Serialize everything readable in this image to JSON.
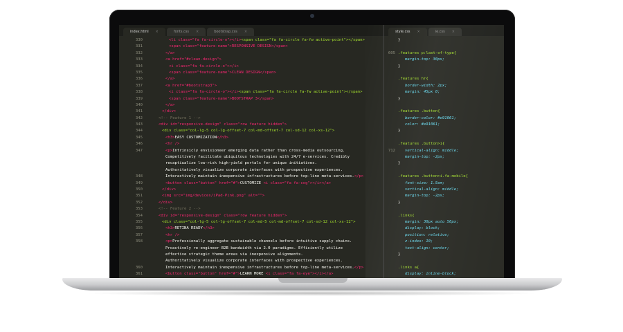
{
  "tabs_left": [
    {
      "label": "index.html",
      "active": true
    },
    {
      "label": "fonts.css",
      "active": false
    },
    {
      "label": "bootstrap.css",
      "active": false
    }
  ],
  "tabs_right": [
    {
      "label": "style.css",
      "active": true
    },
    {
      "label": "ie.css",
      "active": false
    }
  ],
  "left_lines": [
    {
      "n": "330",
      "segs": [
        [
          "<li class=\"fa fa-circle-o\"></i>",
          "t-tag"
        ],
        [
          "<span class=\"fa fa-circle fa-fw active-point\"></span>",
          "t-attr"
        ]
      ]
    },
    {
      "n": "331",
      "segs": [
        [
          "<span class=\"feature-name\">RESPONSIVE DESIGN</span>",
          "t-tag"
        ]
      ]
    },
    {
      "n": "332",
      "segs": [
        [
          "</a>",
          "t-tag"
        ]
      ]
    },
    {
      "n": "333",
      "segs": [
        [
          "<a href=\"#clean-design\">",
          "t-tag"
        ]
      ]
    },
    {
      "n": "334",
      "segs": [
        [
          "<i class=\"fa fa-circle-o\"></i>",
          "t-tag"
        ]
      ]
    },
    {
      "n": "335",
      "segs": [
        [
          "<span class=\"feature-name\">CLEAN DESIGN</span>",
          "t-tag"
        ]
      ]
    },
    {
      "n": "336",
      "segs": [
        [
          "</a>",
          "t-tag"
        ]
      ]
    },
    {
      "n": "337",
      "segs": [
        [
          "<a href=\"#bootstrap3\">",
          "t-tag"
        ]
      ]
    },
    {
      "n": "338",
      "segs": [
        [
          "<i class=\"fa fa-circle-o\"></i>",
          "t-tag"
        ],
        [
          "<span class=\"fa fa-circle fa-fw active-point\"></span>",
          "t-attr"
        ]
      ]
    },
    {
      "n": "339",
      "segs": [
        [
          "<span class=\"feature-name\">BOOTSTRAP 3</span>",
          "t-tag"
        ]
      ]
    },
    {
      "n": "340",
      "segs": [
        [
          "</a>",
          "t-tag"
        ]
      ]
    },
    {
      "n": "341",
      "segs": [
        [
          "</div>",
          "t-tag"
        ]
      ]
    },
    {
      "n": "342",
      "segs": [
        [
          "<!-- Feature 1 -->",
          "t-com"
        ]
      ]
    },
    {
      "n": "343",
      "segs": [
        [
          "<div id=\"responsive-design\" class=\"row feature hidden\">",
          "t-tag"
        ]
      ]
    },
    {
      "n": "344",
      "segs": [
        [
          "<div class=\"col-lg-5 col-lg-offset-7 col-md-offset-7 col-sd-12 col-xs-12\">",
          "t-attr"
        ]
      ]
    },
    {
      "n": "345",
      "segs": [
        [
          "<h3>",
          "t-tag"
        ],
        [
          "EASY CUSTOMIZATION",
          "txt"
        ],
        [
          "</h3>",
          "t-tag"
        ]
      ]
    },
    {
      "n": "346",
      "segs": [
        [
          "<hr />",
          "t-tag"
        ]
      ]
    },
    {
      "n": "347",
      "segs": [
        [
          "<p>",
          "t-tag"
        ],
        [
          "Intrinsicly envisioneer emerging data rather than cross-media outsourcing.",
          "txt"
        ]
      ]
    },
    {
      "n": "",
      "segs": [
        [
          "Competitively facilitate ubiquitous technologies with 24/7 e-services. Credibly",
          "txt"
        ]
      ]
    },
    {
      "n": "",
      "segs": [
        [
          "recaptiualize low-risk high-yield portals for unique initiatives.",
          "txt"
        ]
      ]
    },
    {
      "n": "",
      "segs": [
        [
          "Authoritatively visualize corporate interfaces with prospective experiences.",
          "txt"
        ]
      ]
    },
    {
      "n": "348",
      "segs": [
        [
          "Interactively maintain inexpensive infrastructures before top-line meta-services.",
          "txt"
        ],
        [
          "</p>",
          "t-tag"
        ]
      ]
    },
    {
      "n": "349",
      "segs": [
        [
          "<button class=\"button\" href=\"#\">",
          "t-tag"
        ],
        [
          "CUSTOMIZE ",
          "txt"
        ],
        [
          "<i class=\"fa fa-cog\"></i></a>",
          "t-tag"
        ]
      ]
    },
    {
      "n": "350",
      "segs": [
        [
          "</div>",
          "t-tag"
        ]
      ]
    },
    {
      "n": "351",
      "segs": [
        [
          "<img src=\"img/devices/iPad-Pink.png\" alt=\"\">",
          "t-tag"
        ]
      ]
    },
    {
      "n": "352",
      "segs": [
        [
          "</div>",
          "t-tag"
        ]
      ]
    },
    {
      "n": "353",
      "segs": [
        [
          "<!-- Feature 2 -->",
          "t-com"
        ]
      ]
    },
    {
      "n": "354",
      "segs": [
        [
          "<div id=\"responsive-design\" class=\"row feature hidden\">",
          "t-tag"
        ]
      ]
    },
    {
      "n": "355",
      "segs": [
        [
          "<div class=\"col-lg-5 col-lg-offset-7 col-md-5 col-md-offset-7 col-sd-12 col-xs-12\">",
          "t-attr"
        ]
      ]
    },
    {
      "n": "356",
      "segs": [
        [
          "<h3>",
          "t-tag"
        ],
        [
          "RETINA READY",
          "txt"
        ],
        [
          "</h3>",
          "t-tag"
        ]
      ]
    },
    {
      "n": "357",
      "segs": [
        [
          "<hr />",
          "t-tag"
        ]
      ]
    },
    {
      "n": "358",
      "segs": [
        [
          "<p>",
          "t-tag"
        ],
        [
          "Professionally aggregate sustainable channels before intuitive supply chains.",
          "txt"
        ]
      ]
    },
    {
      "n": "",
      "segs": [
        [
          "Proactively re-engineer B2B bandwidth via 2.0 paradigms. Efficiently utilize",
          "txt"
        ]
      ]
    },
    {
      "n": "",
      "segs": [
        [
          "effective strategic theme areas via inexpensive alignments.",
          "txt"
        ]
      ]
    },
    {
      "n": "",
      "segs": [
        [
          "Authoritatively visualize corporate interfaces with prospective experiences.",
          "txt"
        ]
      ]
    },
    {
      "n": "360",
      "segs": [
        [
          "Interactively maintain inexpensive infrastructures before top-line meta-services.",
          "txt"
        ],
        [
          "</p>",
          "t-tag"
        ]
      ]
    },
    {
      "n": "361",
      "segs": [
        [
          "<button class=\"button\" href=\"#\">",
          "t-tag"
        ],
        [
          "LEARN MORE ",
          "txt"
        ],
        [
          "<i class=\"fa fa-eye\"></i></a>",
          "t-tag"
        ]
      ]
    },
    {
      "n": "362",
      "segs": [
        [
          "</div>",
          "t-tag"
        ]
      ]
    },
    {
      "n": "363",
      "segs": [
        [
          "<img src=\"img/devices/iPad-Pink.png\" alt=\"\">",
          "t-tag"
        ]
      ]
    },
    {
      "n": "364",
      "segs": [
        [
          "</div>",
          "t-tag"
        ]
      ]
    },
    {
      "n": "365",
      "segs": [
        [
          "<!-- Feature 3 -->",
          "t-com"
        ]
      ]
    },
    {
      "n": "366",
      "segs": [
        [
          "<div id=\"responsive-design\" class=\"row feature hidden\">",
          "t-tag"
        ]
      ]
    }
  ],
  "right_lines": [
    {
      "n": "",
      "segs": [
        [
          "}",
          "t-pun"
        ]
      ]
    },
    {
      "n": "",
      "segs": [
        [
          "",
          "txt"
        ]
      ]
    },
    {
      "n": "",
      "segs": [
        [
          ".features p:last-of-type{",
          "t-sel"
        ]
      ]
    },
    {
      "n": "",
      "segs": [
        [
          "margin-top: 30px;",
          "t-prop"
        ]
      ]
    },
    {
      "n": "",
      "segs": [
        [
          "}",
          "t-pun"
        ]
      ]
    },
    {
      "n": "",
      "segs": [
        [
          "",
          "txt"
        ]
      ]
    },
    {
      "n": "",
      "segs": [
        [
          ".features hr{",
          "t-sel"
        ]
      ]
    },
    {
      "n": "",
      "segs": [
        [
          "border-width: 2px;",
          "t-prop"
        ]
      ]
    },
    {
      "n": "",
      "segs": [
        [
          "margin: 45px 0;",
          "t-prop"
        ]
      ]
    },
    {
      "n": "",
      "segs": [
        [
          "}",
          "t-pun"
        ]
      ]
    },
    {
      "n": "",
      "segs": [
        [
          "",
          "txt"
        ]
      ]
    },
    {
      "n": "",
      "segs": [
        [
          ".features .button{",
          "t-sel"
        ]
      ]
    },
    {
      "n": "",
      "segs": [
        [
          "border-color: #e91061;",
          "t-prop"
        ]
      ]
    },
    {
      "n": "",
      "segs": [
        [
          "color: #e91061;",
          "t-prop"
        ]
      ]
    },
    {
      "n": "",
      "segs": [
        [
          "}",
          "t-pun"
        ]
      ]
    },
    {
      "n": "",
      "segs": [
        [
          "",
          "txt"
        ]
      ]
    },
    {
      "n": "",
      "segs": [
        [
          ".features .button>i{",
          "t-sel"
        ]
      ]
    },
    {
      "n": "",
      "segs": [
        [
          "vertical-align: middle;",
          "t-prop"
        ]
      ]
    },
    {
      "n": "",
      "segs": [
        [
          "margin-top: -2px;",
          "t-prop"
        ]
      ]
    },
    {
      "n": "",
      "segs": [
        [
          "}",
          "t-pun"
        ]
      ]
    },
    {
      "n": "",
      "segs": [
        [
          "",
          "txt"
        ]
      ]
    },
    {
      "n": "",
      "segs": [
        [
          ".features .button>i.fa-mobile{",
          "t-sel"
        ]
      ]
    },
    {
      "n": "",
      "segs": [
        [
          "font-size: 1.5em;",
          "t-prop"
        ]
      ]
    },
    {
      "n": "",
      "segs": [
        [
          "vertical-align: middle;",
          "t-prop"
        ]
      ]
    },
    {
      "n": "",
      "segs": [
        [
          "margin-top: -2px;",
          "t-prop"
        ]
      ]
    },
    {
      "n": "",
      "segs": [
        [
          "}",
          "t-pun"
        ]
      ]
    },
    {
      "n": "",
      "segs": [
        [
          "",
          "txt"
        ]
      ]
    },
    {
      "n": "",
      "segs": [
        [
          ".links{",
          "t-sel"
        ]
      ]
    },
    {
      "n": "",
      "segs": [
        [
          "margin: 30px auto 50px;",
          "t-prop"
        ]
      ]
    },
    {
      "n": "",
      "segs": [
        [
          "display: block;",
          "t-prop"
        ]
      ]
    },
    {
      "n": "",
      "segs": [
        [
          "position: relative;",
          "t-prop"
        ]
      ]
    },
    {
      "n": "",
      "segs": [
        [
          "z-index: 10;",
          "t-prop"
        ]
      ]
    },
    {
      "n": "",
      "segs": [
        [
          "text-align: center;",
          "t-prop"
        ]
      ]
    },
    {
      "n": "",
      "segs": [
        [
          "}",
          "t-pun"
        ]
      ]
    },
    {
      "n": "",
      "segs": [
        [
          "",
          "txt"
        ]
      ]
    },
    {
      "n": "",
      "segs": [
        [
          ".links a{",
          "t-sel"
        ]
      ]
    },
    {
      "n": "",
      "segs": [
        [
          "display: inline-block;",
          "t-prop"
        ]
      ]
    },
    {
      "n": "",
      "segs": [
        [
          "color: #b0b0c0;",
          "t-prop"
        ]
      ]
    },
    {
      "n": "",
      "segs": [
        [
          "position: relative;",
          "t-prop"
        ]
      ]
    },
    {
      "n": "",
      "segs": [
        [
          "}",
          "t-pun"
        ]
      ]
    },
    {
      "n": "",
      "segs": [
        [
          "",
          "txt"
        ]
      ]
    },
    {
      "n": "",
      "segs": [
        [
          ".links hr{",
          "t-sel"
        ]
      ]
    }
  ],
  "right_numbers": [
    "",
    "",
    "605",
    "",
    "",
    "",
    "",
    "",
    "",
    "",
    "",
    "",
    "",
    "",
    "",
    "",
    "",
    "712",
    "",
    "",
    "",
    "",
    "",
    "",
    "",
    "",
    "",
    "",
    "",
    "",
    "",
    "",
    "",
    "",
    "",
    "",
    "",
    "",
    "",
    "",
    "",
    ""
  ]
}
